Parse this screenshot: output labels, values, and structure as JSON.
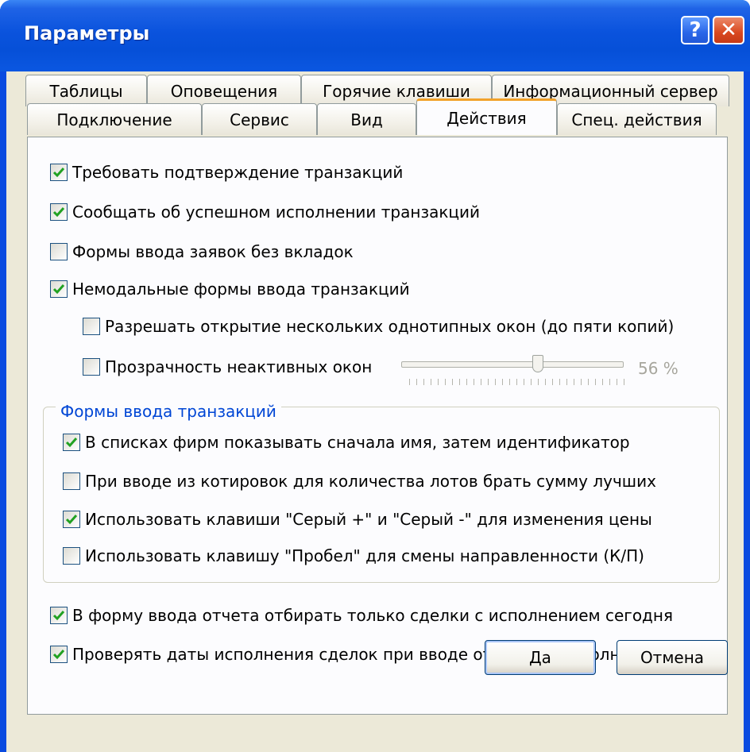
{
  "window": {
    "title": "Параметры",
    "help_glyph": "?",
    "close_glyph": "✕"
  },
  "tabs": {
    "row1": [
      "Таблицы",
      "Оповещения",
      "Горячие клавиши",
      "Информационный сервер"
    ],
    "row2": [
      "Подключение",
      "Сервис",
      "Вид",
      "Действия",
      "Спец. действия"
    ],
    "active": "Действия"
  },
  "options": {
    "require_confirmation": {
      "label": "Требовать подтверждение транзакций",
      "checked": true
    },
    "report_success": {
      "label": "Сообщать об успешном исполнении транзакций",
      "checked": true
    },
    "forms_without_tabs": {
      "label": "Формы ввода заявок без вкладок",
      "checked": false
    },
    "modeless_forms": {
      "label": "Немодальные формы ввода транзакций",
      "checked": true
    },
    "allow_multiple_windows": {
      "label": "Разрешать открытие нескольких однотипных окон (до пяти копий)",
      "checked": false
    },
    "inactive_transparency": {
      "label": "Прозрачность неактивных окон",
      "checked": false
    },
    "transparency_value": "56 %",
    "transparency_level": 0.56
  },
  "group": {
    "title": "Формы ввода транзакций",
    "name_first": {
      "label": "В списках фирм показывать сначала имя, затем идентификатор",
      "checked": true
    },
    "sum_best_lots": {
      "label": "При вводе из котировок для количества лотов брать сумму лучших",
      "checked": false
    },
    "gray_keys": {
      "label": "Использовать клавиши \"Серый +\" и \"Серый -\" для изменения цены",
      "checked": true
    },
    "space_key": {
      "label": "Использовать клавишу \"Пробел\" для смены направленности (К/П)",
      "checked": false
    }
  },
  "report": {
    "today_only": {
      "label": "В форму ввода отчета отбирать только сделки с исполнением сегодня",
      "checked": true
    },
    "check_dates": {
      "label": "Проверять даты исполнения сделок при вводе отчета на исполнение",
      "checked": true
    }
  },
  "buttons": {
    "ok": "Да",
    "cancel": "Отмена"
  },
  "colors": {
    "titlebar": "#0a53dd",
    "dialog_bg": "#ece9d8",
    "active_tab_accent": "#f2a22a",
    "group_title": "#0046d5",
    "checkmark": "#21a121"
  }
}
